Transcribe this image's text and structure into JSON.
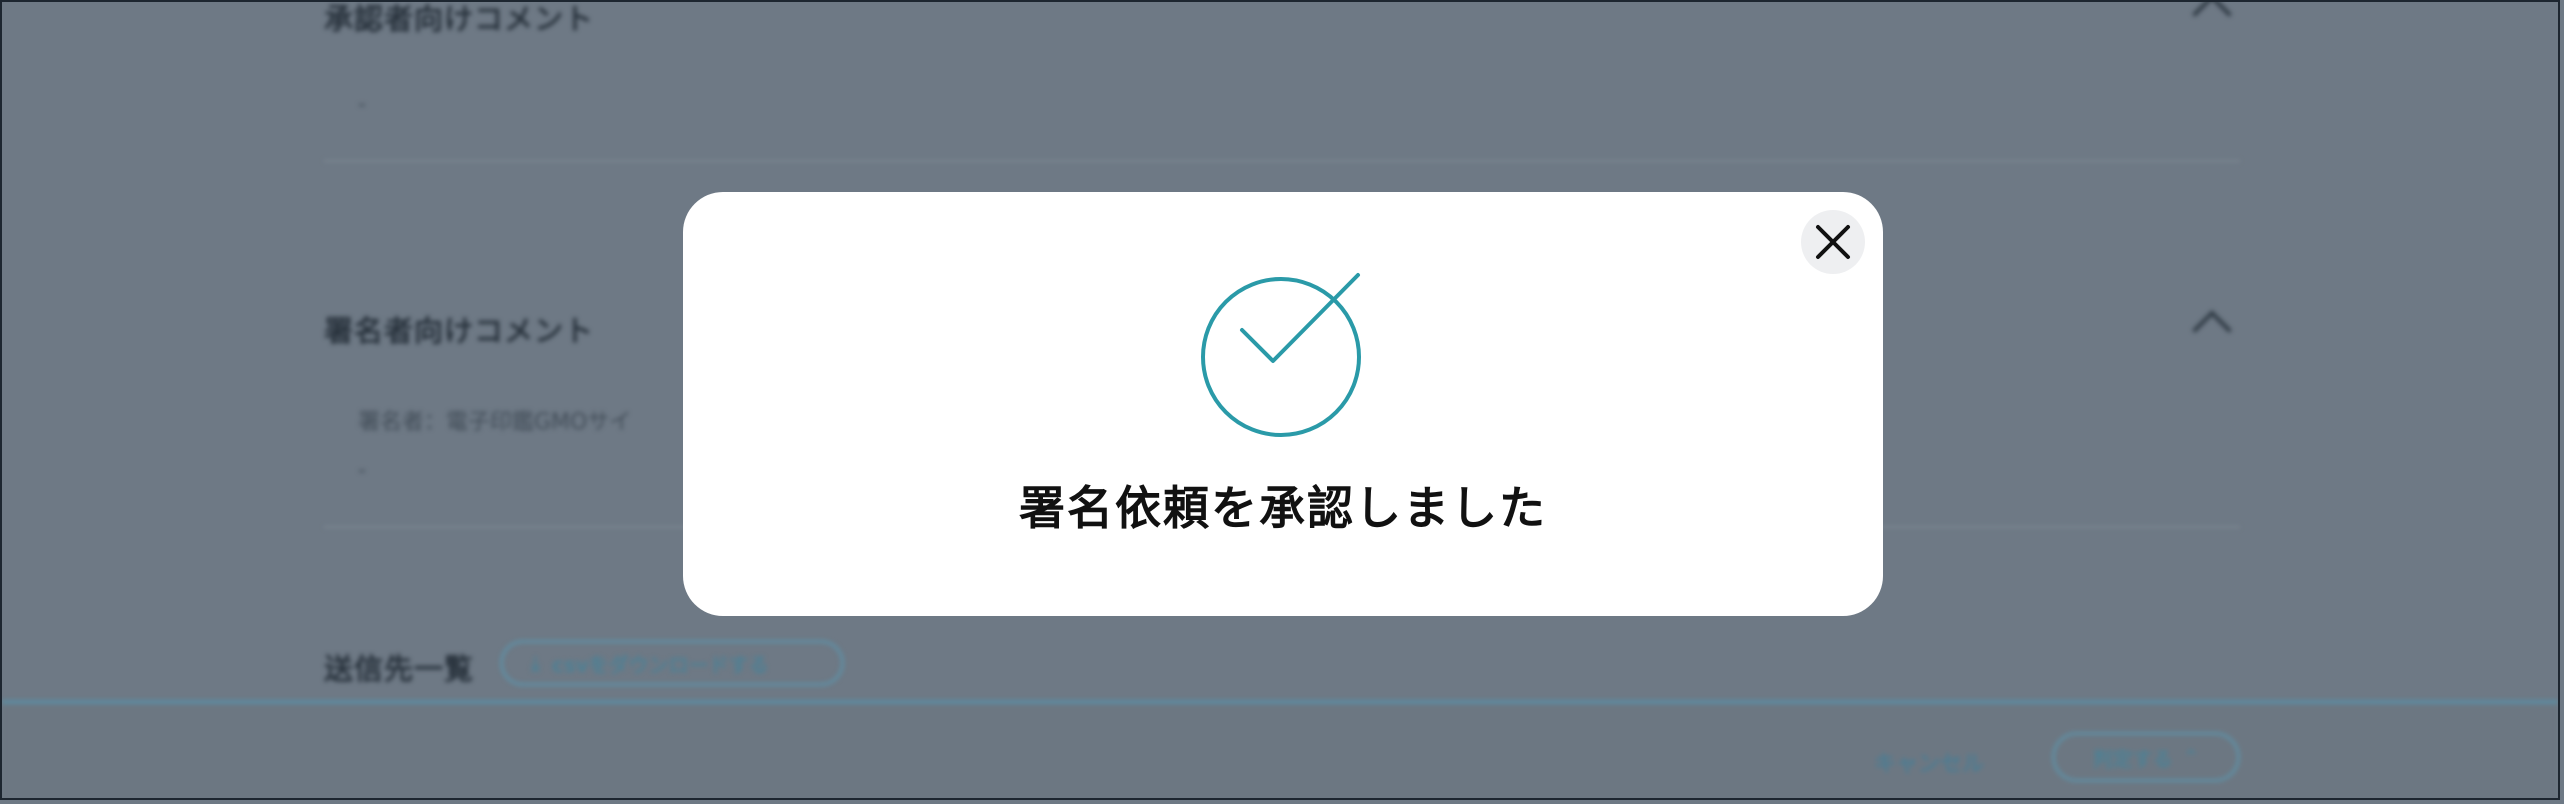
{
  "background": {
    "approver_comment": {
      "title": "承認者向けコメント",
      "body": "-"
    },
    "signer_comment": {
      "title": "署名者向けコメント",
      "signer_line": "署名者：電子印鑑GMOサイ",
      "body": "-"
    },
    "recipients": {
      "title": "送信先一覧",
      "csv_button": "csvをダウンロードする"
    },
    "footer": {
      "cancel": "キャンセル",
      "judge": "判定する"
    }
  },
  "modal": {
    "message": "署名依頼を承認しました",
    "close_icon": "close-icon",
    "status_icon": "check-circle-icon",
    "accent_color": "#2a9aa8"
  }
}
